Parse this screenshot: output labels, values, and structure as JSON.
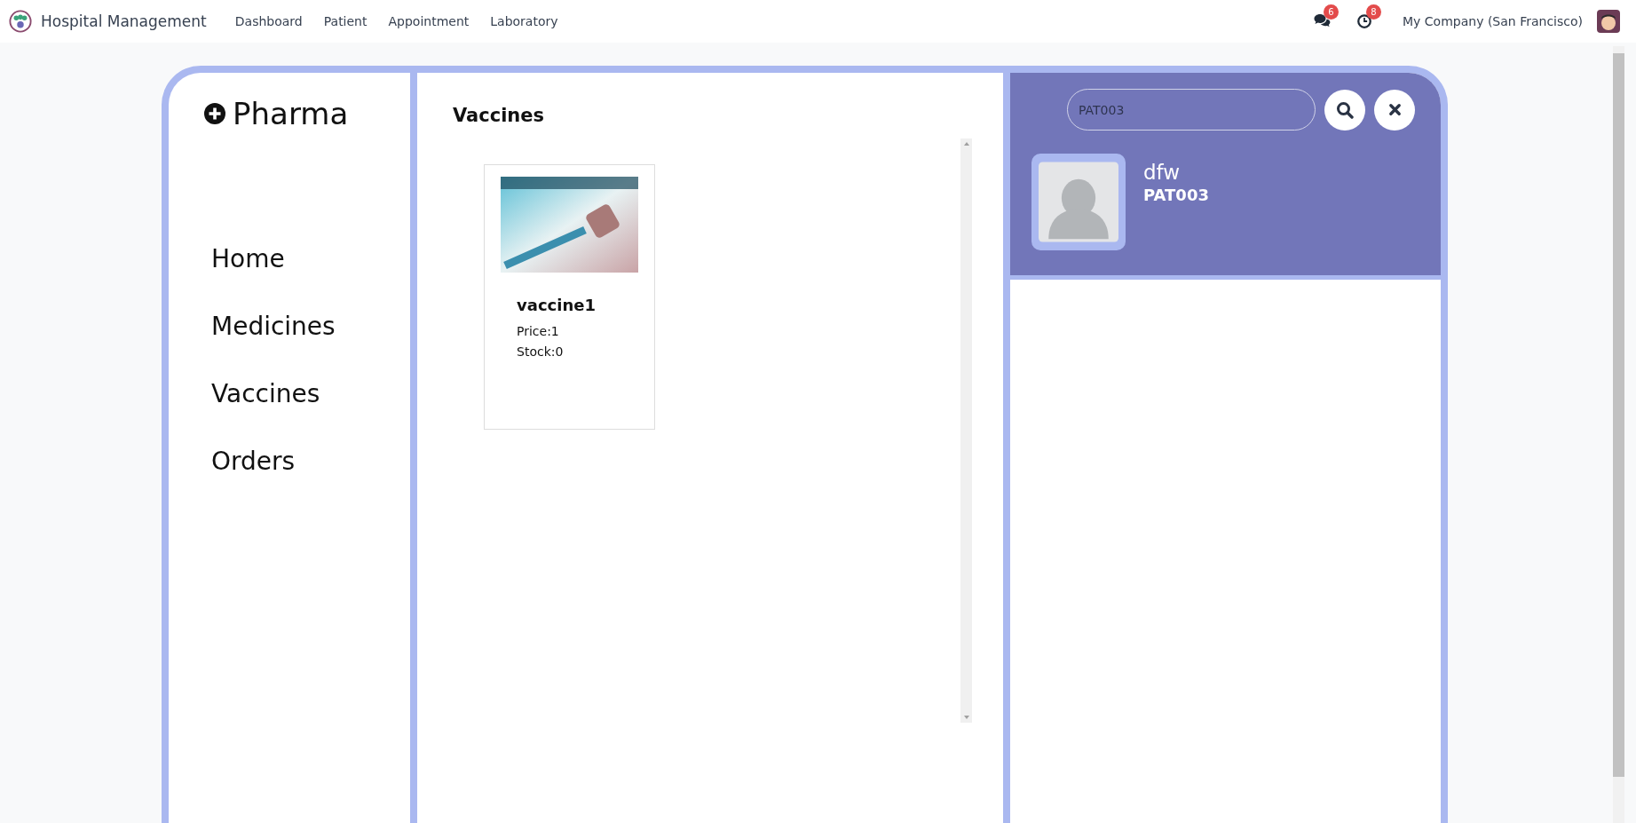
{
  "navbar": {
    "app_name": "Hospital Management",
    "menu": [
      "Dashboard",
      "Patient",
      "Appointment",
      "Laboratory"
    ],
    "messages_count": "6",
    "activities_count": "8",
    "company": "My Company (San Francisco)"
  },
  "sidebar": {
    "title": "Pharma",
    "items": [
      "Home",
      "Medicines",
      "Vaccines",
      "Orders"
    ]
  },
  "content": {
    "title": "Vaccines",
    "products": [
      {
        "name": "vaccine1",
        "price": "Price:1",
        "stock": "Stock:0"
      }
    ]
  },
  "patient_panel": {
    "search": {
      "value": "PAT003"
    },
    "patient": {
      "name": "dfw",
      "code": "PAT003"
    }
  }
}
